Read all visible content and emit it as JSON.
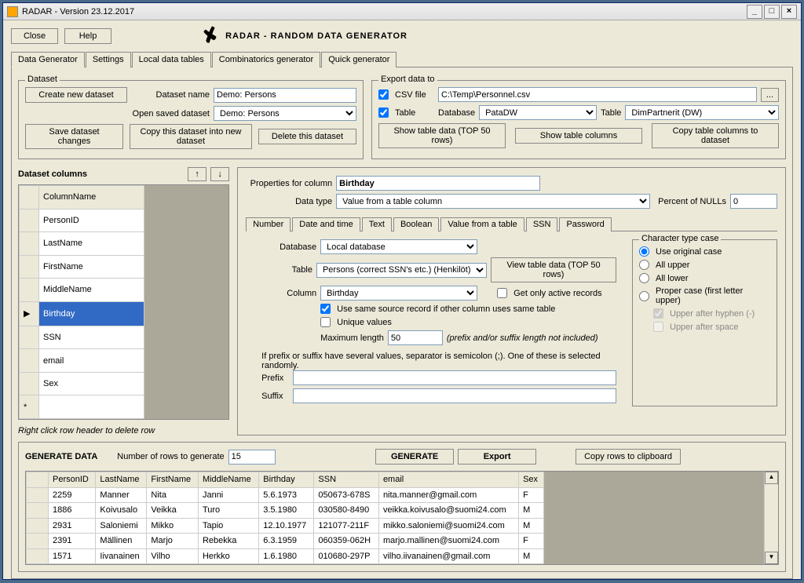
{
  "window": {
    "title": "RADAR - Version 23.12.2017"
  },
  "appTitle": "RADAR - RANDOM DATA GENERATOR",
  "toolbar": {
    "close": "Close",
    "help": "Help"
  },
  "mainTabs": [
    "Data Generator",
    "Settings",
    "Local data tables",
    "Combinatorics generator",
    "Quick generator"
  ],
  "dataset": {
    "groupTitle": "Dataset",
    "createBtn": "Create new dataset",
    "nameLabel": "Dataset name",
    "nameValue": "Demo: Persons",
    "openLabel": "Open saved dataset",
    "openValue": "Demo: Persons",
    "saveBtn": "Save dataset changes",
    "copyBtn": "Copy this dataset into new dataset",
    "deleteBtn": "Delete this  dataset"
  },
  "export": {
    "groupTitle": "Export data to",
    "csvLabel": "CSV file",
    "csvValue": "C:\\Temp\\Personnel.csv",
    "browseBtn": "...",
    "tableLabel": "Table",
    "dbLabel": "Database",
    "dbValue": "PataDW",
    "tableSelLabel": "Table",
    "tableValue": "DimPartnerit (DW)",
    "showDataBtn": "Show table data (TOP 50 rows)",
    "showColsBtn": "Show table columns",
    "copyColsBtn": "Copy table columns to dataset"
  },
  "columns": {
    "title": "Dataset columns",
    "upBtn": "↑",
    "downBtn": "↓",
    "header": "ColumnName",
    "items": [
      "PersonID",
      "LastName",
      "FirstName",
      "MiddleName",
      "Birthday",
      "SSN",
      "email",
      "Sex"
    ],
    "selectedIndex": 4,
    "hint": "Right click row header to delete row"
  },
  "props": {
    "colLabel": "Properties for column",
    "colValue": "Birthday",
    "typeLabel": "Data type",
    "typeValue": "Value from a  table column",
    "nullsLabel": "Percent of NULLs",
    "nullsValue": "0",
    "tabs": [
      "Number",
      "Date and time",
      "Text",
      "Boolean",
      "Value from a table",
      "SSN",
      "Password"
    ],
    "activeTab": 4,
    "dbLabel": "Database",
    "dbValue": "Local database",
    "tableLabel": "Table",
    "tableValue": "Persons (correct SSN's etc.) (Henkilöt)",
    "viewBtn": "View table data (TOP 50 rows)",
    "columnLabel": "Column",
    "columnValue": "Birthday",
    "activeLabel": "Get only active records",
    "sameSourceLabel": "Use same source record if other column uses same table",
    "uniqueLabel": "Unique values",
    "maxLenLabel": "Maximum length",
    "maxLenValue": "50",
    "maxLenHint": "(prefix and/or suffix length not included)",
    "prefixHint": "If prefix or suffix have several values, separator is semicolon (;). One of these is selected randomly.",
    "prefixLabel": "Prefix",
    "suffixLabel": "Suffix",
    "caseGroup": "Character type case",
    "caseOptions": [
      "Use original case",
      "All upper",
      "All lower",
      "Proper case (first letter upper)"
    ],
    "hyphenLabel": "Upper after hyphen (-)",
    "spaceLabel": "Upper after space"
  },
  "generate": {
    "title": "GENERATE DATA",
    "rowsLabel": "Number of rows to generate",
    "rowsValue": "15",
    "genBtn": "GENERATE",
    "exportBtn": "Export",
    "clipBtn": "Copy rows to clipboard",
    "headers": [
      "PersonID",
      "LastName",
      "FirstName",
      "MiddleName",
      "Birthday",
      "SSN",
      "email",
      "Sex"
    ],
    "rows": [
      [
        "2259",
        "Manner",
        "Nita",
        "Janni",
        "5.6.1973",
        "050673-678S",
        "nita.manner@gmail.com",
        "F"
      ],
      [
        "1886",
        "Koivusalo",
        "Veikka",
        "Turo",
        "3.5.1980",
        "030580-8490",
        "veikka.koivusalo@suomi24.com",
        "M"
      ],
      [
        "2931",
        "Saloniemi",
        "Mikko",
        "Tapio",
        "12.10.1977",
        "121077-211F",
        "mikko.saloniemi@suomi24.com",
        "M"
      ],
      [
        "2391",
        "Mällinen",
        "Marjo",
        "Rebekka",
        "6.3.1959",
        "060359-062H",
        "marjo.mallinen@suomi24.com",
        "F"
      ],
      [
        "1571",
        "Iivanainen",
        "Vilho",
        "Herkko",
        "1.6.1980",
        "010680-297P",
        "vilho.iivanainen@gmail.com",
        "M"
      ]
    ]
  }
}
